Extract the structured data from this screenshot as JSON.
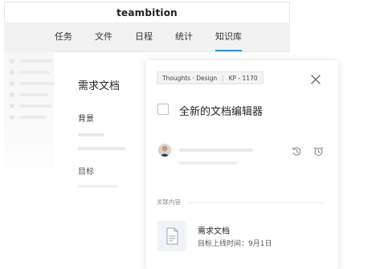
{
  "app": {
    "title": "teambition",
    "tabs": [
      {
        "label": "任务",
        "active": false
      },
      {
        "label": "文件",
        "active": false
      },
      {
        "label": "日程",
        "active": false
      },
      {
        "label": "统计",
        "active": false
      },
      {
        "label": "知识库",
        "active": true
      }
    ]
  },
  "document": {
    "title": "需求文档",
    "sections": [
      "背景",
      "目标"
    ]
  },
  "task_card": {
    "breadcrumb": {
      "project": "Thoughts · Design",
      "id": "KP - 1170"
    },
    "task_title": "全新的文档编辑器",
    "linked_section_label": "关联内容",
    "linked_item": {
      "title": "需求文档",
      "subtitle": "目标上线时间：9月1日"
    },
    "icons": {
      "close": "close-icon",
      "history": "history-icon",
      "alarm": "alarm-clock-icon",
      "document": "document-icon"
    }
  },
  "colors": {
    "accent": "#1b9aee",
    "nav_background": "#f2f2f2",
    "placeholder": "#e9e9e9"
  }
}
